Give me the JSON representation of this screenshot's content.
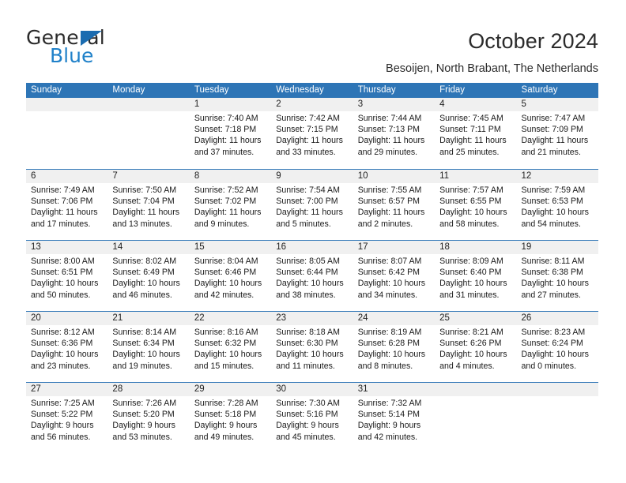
{
  "brand": {
    "name_top": "General",
    "name_bottom": "Blue"
  },
  "header": {
    "title": "October 2024",
    "subtitle": "Besoijen, North Brabant, The Netherlands"
  },
  "colors": {
    "header_blue": "#2e75b6",
    "logo_blue": "#2081c9",
    "date_band": "#f0f0f0"
  },
  "calendar": {
    "day_headers": [
      "Sunday",
      "Monday",
      "Tuesday",
      "Wednesday",
      "Thursday",
      "Friday",
      "Saturday"
    ],
    "weeks": [
      [
        {
          "day": "",
          "sunrise": "",
          "sunset": "",
          "daylight1": "",
          "daylight2": ""
        },
        {
          "day": "",
          "sunrise": "",
          "sunset": "",
          "daylight1": "",
          "daylight2": ""
        },
        {
          "day": "1",
          "sunrise": "Sunrise: 7:40 AM",
          "sunset": "Sunset: 7:18 PM",
          "daylight1": "Daylight: 11 hours",
          "daylight2": "and 37 minutes."
        },
        {
          "day": "2",
          "sunrise": "Sunrise: 7:42 AM",
          "sunset": "Sunset: 7:15 PM",
          "daylight1": "Daylight: 11 hours",
          "daylight2": "and 33 minutes."
        },
        {
          "day": "3",
          "sunrise": "Sunrise: 7:44 AM",
          "sunset": "Sunset: 7:13 PM",
          "daylight1": "Daylight: 11 hours",
          "daylight2": "and 29 minutes."
        },
        {
          "day": "4",
          "sunrise": "Sunrise: 7:45 AM",
          "sunset": "Sunset: 7:11 PM",
          "daylight1": "Daylight: 11 hours",
          "daylight2": "and 25 minutes."
        },
        {
          "day": "5",
          "sunrise": "Sunrise: 7:47 AM",
          "sunset": "Sunset: 7:09 PM",
          "daylight1": "Daylight: 11 hours",
          "daylight2": "and 21 minutes."
        }
      ],
      [
        {
          "day": "6",
          "sunrise": "Sunrise: 7:49 AM",
          "sunset": "Sunset: 7:06 PM",
          "daylight1": "Daylight: 11 hours",
          "daylight2": "and 17 minutes."
        },
        {
          "day": "7",
          "sunrise": "Sunrise: 7:50 AM",
          "sunset": "Sunset: 7:04 PM",
          "daylight1": "Daylight: 11 hours",
          "daylight2": "and 13 minutes."
        },
        {
          "day": "8",
          "sunrise": "Sunrise: 7:52 AM",
          "sunset": "Sunset: 7:02 PM",
          "daylight1": "Daylight: 11 hours",
          "daylight2": "and 9 minutes."
        },
        {
          "day": "9",
          "sunrise": "Sunrise: 7:54 AM",
          "sunset": "Sunset: 7:00 PM",
          "daylight1": "Daylight: 11 hours",
          "daylight2": "and 5 minutes."
        },
        {
          "day": "10",
          "sunrise": "Sunrise: 7:55 AM",
          "sunset": "Sunset: 6:57 PM",
          "daylight1": "Daylight: 11 hours",
          "daylight2": "and 2 minutes."
        },
        {
          "day": "11",
          "sunrise": "Sunrise: 7:57 AM",
          "sunset": "Sunset: 6:55 PM",
          "daylight1": "Daylight: 10 hours",
          "daylight2": "and 58 minutes."
        },
        {
          "day": "12",
          "sunrise": "Sunrise: 7:59 AM",
          "sunset": "Sunset: 6:53 PM",
          "daylight1": "Daylight: 10 hours",
          "daylight2": "and 54 minutes."
        }
      ],
      [
        {
          "day": "13",
          "sunrise": "Sunrise: 8:00 AM",
          "sunset": "Sunset: 6:51 PM",
          "daylight1": "Daylight: 10 hours",
          "daylight2": "and 50 minutes."
        },
        {
          "day": "14",
          "sunrise": "Sunrise: 8:02 AM",
          "sunset": "Sunset: 6:49 PM",
          "daylight1": "Daylight: 10 hours",
          "daylight2": "and 46 minutes."
        },
        {
          "day": "15",
          "sunrise": "Sunrise: 8:04 AM",
          "sunset": "Sunset: 6:46 PM",
          "daylight1": "Daylight: 10 hours",
          "daylight2": "and 42 minutes."
        },
        {
          "day": "16",
          "sunrise": "Sunrise: 8:05 AM",
          "sunset": "Sunset: 6:44 PM",
          "daylight1": "Daylight: 10 hours",
          "daylight2": "and 38 minutes."
        },
        {
          "day": "17",
          "sunrise": "Sunrise: 8:07 AM",
          "sunset": "Sunset: 6:42 PM",
          "daylight1": "Daylight: 10 hours",
          "daylight2": "and 34 minutes."
        },
        {
          "day": "18",
          "sunrise": "Sunrise: 8:09 AM",
          "sunset": "Sunset: 6:40 PM",
          "daylight1": "Daylight: 10 hours",
          "daylight2": "and 31 minutes."
        },
        {
          "day": "19",
          "sunrise": "Sunrise: 8:11 AM",
          "sunset": "Sunset: 6:38 PM",
          "daylight1": "Daylight: 10 hours",
          "daylight2": "and 27 minutes."
        }
      ],
      [
        {
          "day": "20",
          "sunrise": "Sunrise: 8:12 AM",
          "sunset": "Sunset: 6:36 PM",
          "daylight1": "Daylight: 10 hours",
          "daylight2": "and 23 minutes."
        },
        {
          "day": "21",
          "sunrise": "Sunrise: 8:14 AM",
          "sunset": "Sunset: 6:34 PM",
          "daylight1": "Daylight: 10 hours",
          "daylight2": "and 19 minutes."
        },
        {
          "day": "22",
          "sunrise": "Sunrise: 8:16 AM",
          "sunset": "Sunset: 6:32 PM",
          "daylight1": "Daylight: 10 hours",
          "daylight2": "and 15 minutes."
        },
        {
          "day": "23",
          "sunrise": "Sunrise: 8:18 AM",
          "sunset": "Sunset: 6:30 PM",
          "daylight1": "Daylight: 10 hours",
          "daylight2": "and 11 minutes."
        },
        {
          "day": "24",
          "sunrise": "Sunrise: 8:19 AM",
          "sunset": "Sunset: 6:28 PM",
          "daylight1": "Daylight: 10 hours",
          "daylight2": "and 8 minutes."
        },
        {
          "day": "25",
          "sunrise": "Sunrise: 8:21 AM",
          "sunset": "Sunset: 6:26 PM",
          "daylight1": "Daylight: 10 hours",
          "daylight2": "and 4 minutes."
        },
        {
          "day": "26",
          "sunrise": "Sunrise: 8:23 AM",
          "sunset": "Sunset: 6:24 PM",
          "daylight1": "Daylight: 10 hours",
          "daylight2": "and 0 minutes."
        }
      ],
      [
        {
          "day": "27",
          "sunrise": "Sunrise: 7:25 AM",
          "sunset": "Sunset: 5:22 PM",
          "daylight1": "Daylight: 9 hours",
          "daylight2": "and 56 minutes."
        },
        {
          "day": "28",
          "sunrise": "Sunrise: 7:26 AM",
          "sunset": "Sunset: 5:20 PM",
          "daylight1": "Daylight: 9 hours",
          "daylight2": "and 53 minutes."
        },
        {
          "day": "29",
          "sunrise": "Sunrise: 7:28 AM",
          "sunset": "Sunset: 5:18 PM",
          "daylight1": "Daylight: 9 hours",
          "daylight2": "and 49 minutes."
        },
        {
          "day": "30",
          "sunrise": "Sunrise: 7:30 AM",
          "sunset": "Sunset: 5:16 PM",
          "daylight1": "Daylight: 9 hours",
          "daylight2": "and 45 minutes."
        },
        {
          "day": "31",
          "sunrise": "Sunrise: 7:32 AM",
          "sunset": "Sunset: 5:14 PM",
          "daylight1": "Daylight: 9 hours",
          "daylight2": "and 42 minutes."
        },
        {
          "day": "",
          "sunrise": "",
          "sunset": "",
          "daylight1": "",
          "daylight2": ""
        },
        {
          "day": "",
          "sunrise": "",
          "sunset": "",
          "daylight1": "",
          "daylight2": ""
        }
      ]
    ]
  }
}
